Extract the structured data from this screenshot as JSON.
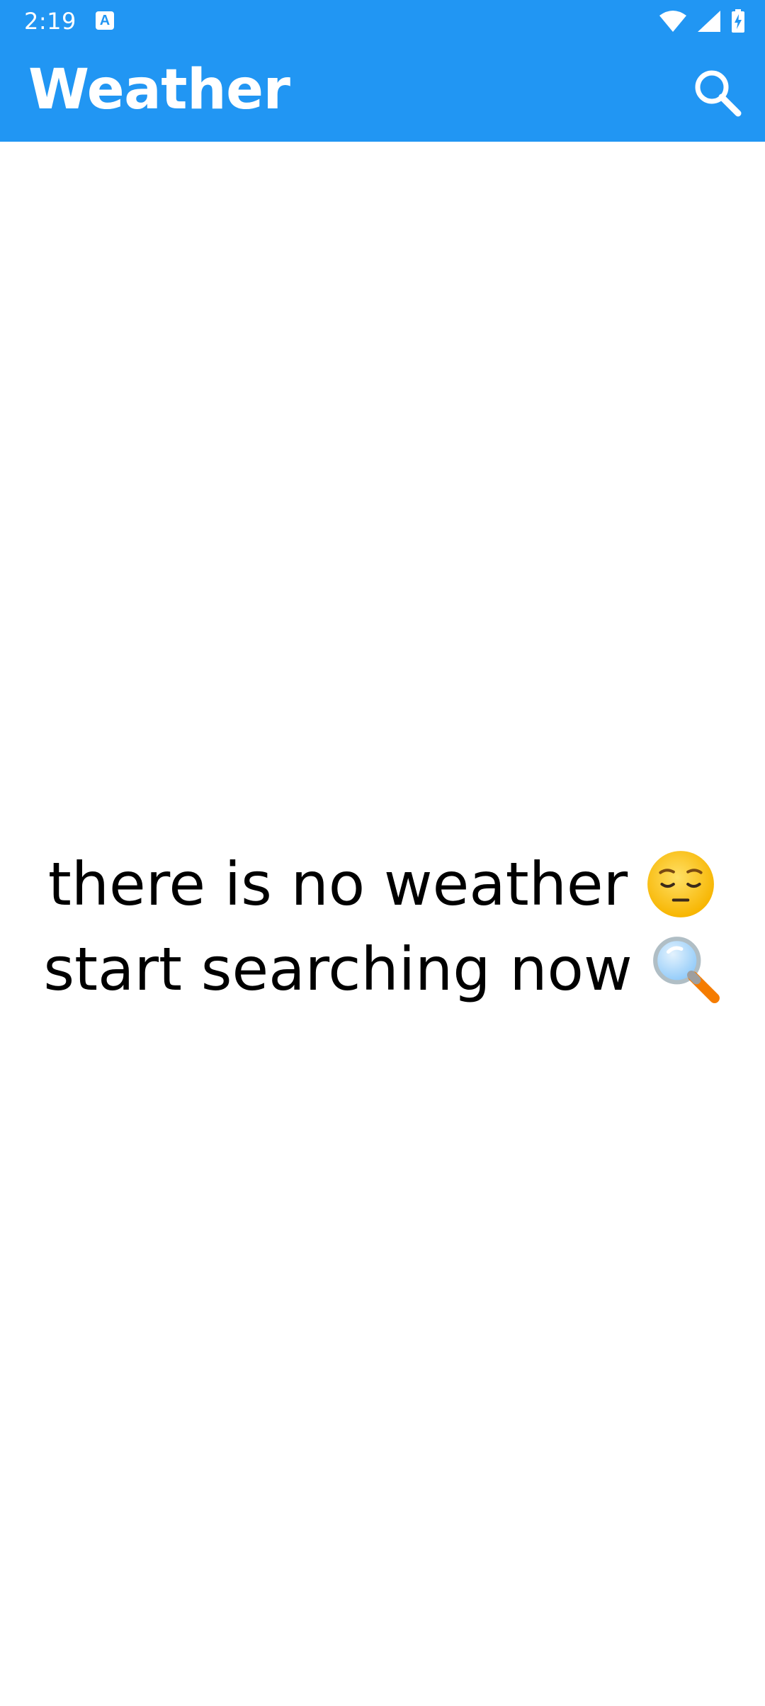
{
  "status_bar": {
    "time": "2:19",
    "notification_icon": "keyboard-a-icon",
    "notification_glyph": "A",
    "icons": [
      "wifi-icon",
      "signal-icon",
      "battery-charging-icon"
    ]
  },
  "app_bar": {
    "title": "Weather",
    "background_color": "#2196F3",
    "action_icon": "search-icon"
  },
  "empty_state": {
    "line1": "there is no weather",
    "line1_emoji": "pensive-face-icon",
    "line2": "start searching now",
    "line2_emoji": "magnifying-glass-icon"
  }
}
